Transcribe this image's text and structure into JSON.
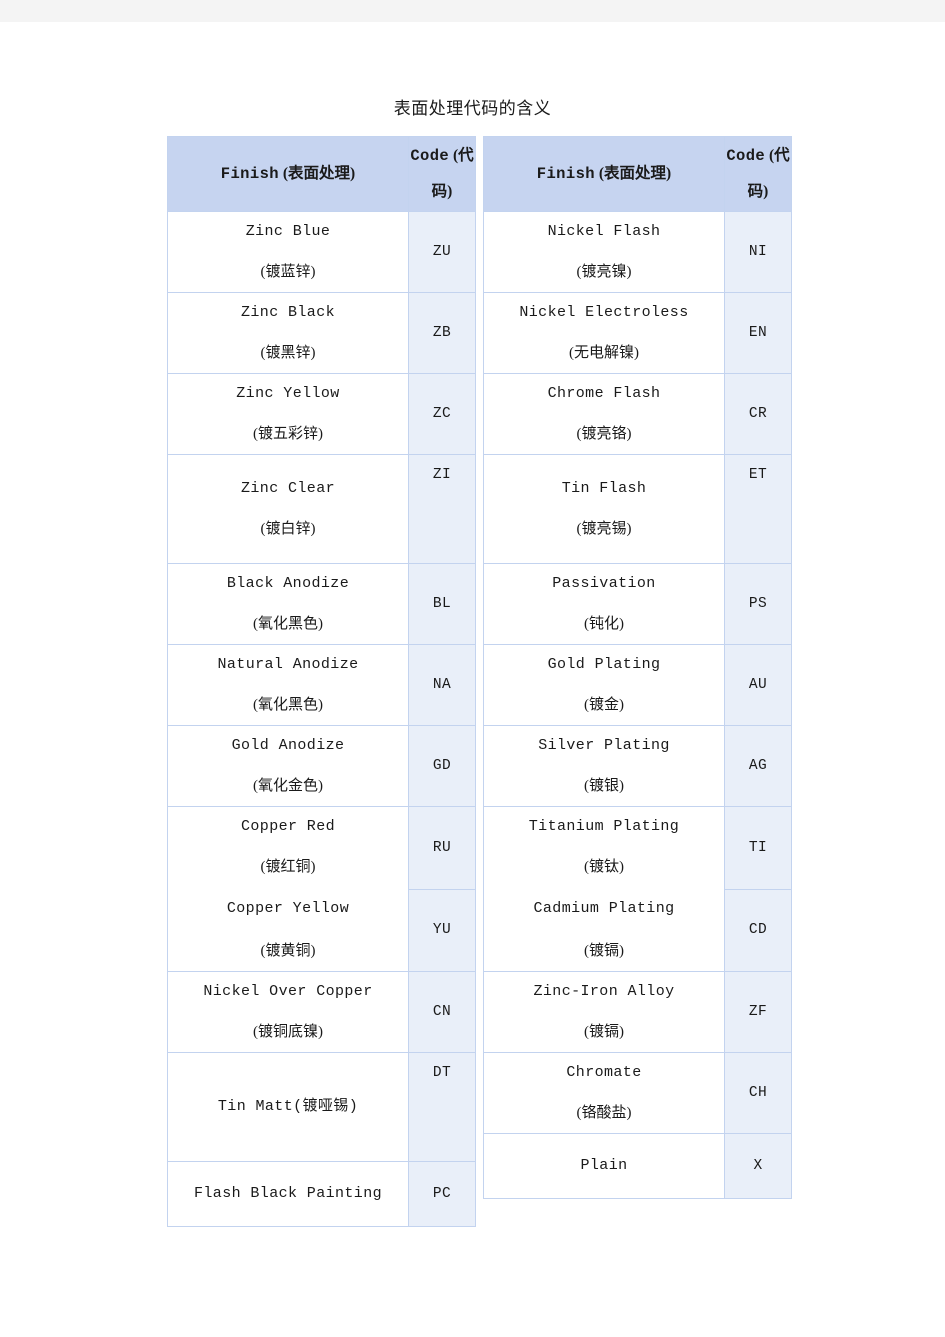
{
  "document": {
    "title": "表面处理代码的含义"
  },
  "table_left": {
    "headers": {
      "finish_en": "Finish",
      "finish_cn": "(表面处理)",
      "code_en": "Code",
      "code_cn": "(代码)"
    },
    "rows": [
      {
        "en": "Zinc Blue",
        "cn": "(镀蓝锌)",
        "code": "ZU",
        "style": "normal"
      },
      {
        "en": "Zinc Black",
        "cn": "(镀黑锌)",
        "code": "ZB",
        "style": "normal"
      },
      {
        "en": "Zinc Yellow",
        "cn": "(镀五彩锌)",
        "code": "ZC",
        "style": "normal"
      },
      {
        "en": "Zinc Clear",
        "cn": "(镀白锌)",
        "code": "ZI",
        "style": "tall"
      },
      {
        "en": "Black Anodize",
        "cn": "(氧化黑色)",
        "code": "BL",
        "style": "normal"
      },
      {
        "en": "Natural Anodize",
        "cn": "(氧化黑色)",
        "code": "NA",
        "style": "normal"
      },
      {
        "en": "Gold Anodize",
        "cn": "(氧化金色)",
        "code": "GD",
        "style": "normal"
      },
      {
        "en": "Copper Red",
        "cn": "(镀红铜)",
        "en2": "Copper Yellow",
        "cn2": "(镀黄铜)",
        "code": "RU",
        "code2": "YU",
        "style": "merge"
      },
      {
        "en": "Nickel Over Copper",
        "cn": "(镀铜底镍)",
        "code": "CN",
        "style": "normal"
      },
      {
        "en": "Tin Matt(镀哑锡)",
        "cn": "",
        "code": "DT",
        "style": "tall"
      },
      {
        "en": "Flash Black Painting",
        "cn": "",
        "code": "PC",
        "style": "single"
      }
    ]
  },
  "table_right": {
    "headers": {
      "finish_en": "Finish",
      "finish_cn": "(表面处理)",
      "code_en": "Code",
      "code_cn": "(代码)"
    },
    "rows": [
      {
        "en": "Nickel Flash",
        "cn": "(镀亮镍)",
        "code": "NI",
        "style": "normal"
      },
      {
        "en": "Nickel Electroless",
        "cn": "(无电解镍)",
        "code": "EN",
        "style": "normal"
      },
      {
        "en": "Chrome Flash",
        "cn": "(镀亮铬)",
        "code": "CR",
        "style": "normal"
      },
      {
        "en": "Tin Flash",
        "cn": "(镀亮锡)",
        "code": "ET",
        "style": "tall"
      },
      {
        "en": "Passivation",
        "cn": "(钝化)",
        "code": "PS",
        "style": "normal"
      },
      {
        "en": "Gold Plating",
        "cn": "(镀金)",
        "code": "AU",
        "style": "normal"
      },
      {
        "en": "Silver Plating",
        "cn": "(镀银)",
        "code": "AG",
        "style": "normal"
      },
      {
        "en": "Titanium Plating",
        "cn": "(镀钛)",
        "en2": "Cadmium Plating",
        "cn2": "(镀镉)",
        "code": "TI",
        "code2": "CD",
        "style": "merge"
      },
      {
        "en": "Zinc-Iron Alloy",
        "cn": "(镀镉)",
        "code": "ZF",
        "style": "normal"
      },
      {
        "en": "Chromate",
        "cn": "(铬酸盐)",
        "code": "CH",
        "style": "normal"
      },
      {
        "en": "Plain",
        "cn": "",
        "code": "X",
        "style": "single"
      }
    ]
  },
  "colors": {
    "header_bg": "#c6d4f0",
    "code_bg": "#e9eff9",
    "border": "#c3d3ef",
    "text": "#1a1a1a",
    "top_band": "#f4f4f4"
  }
}
